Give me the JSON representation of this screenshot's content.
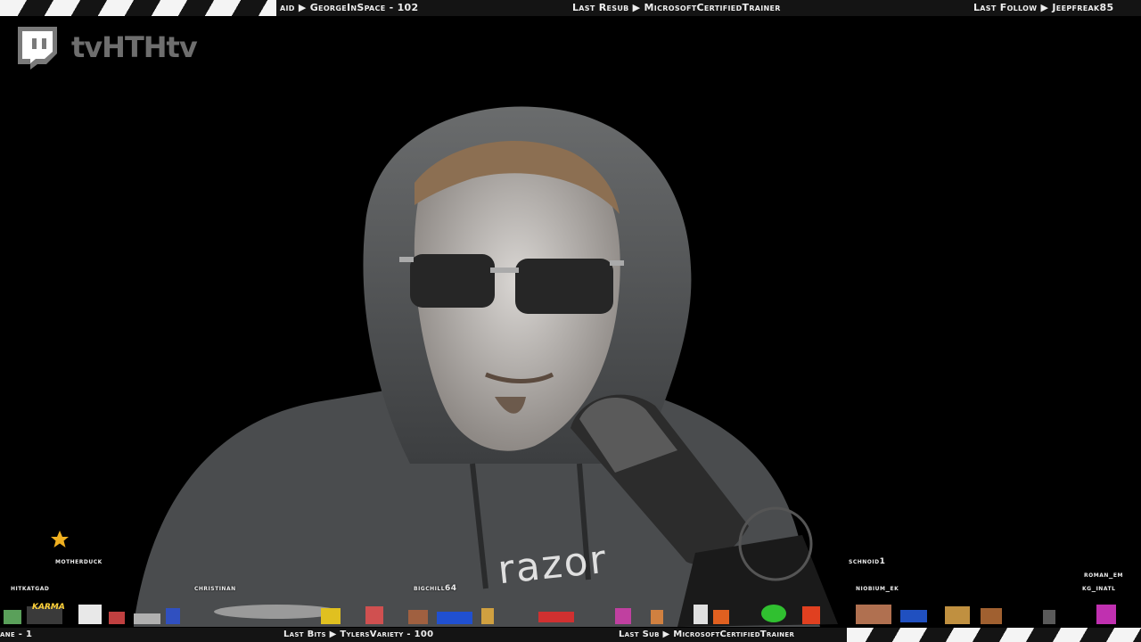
{
  "ticker_top": {
    "last_raid": "aid ▶ GeorgeInSpace - 102",
    "last_resub": "Last Resub ▶ MicrosoftCertifiedTrainer",
    "last_follow": "Last Follow ▶ Jeepfreak85"
  },
  "ticker_bottom": {
    "left_fragment": "ane - 1",
    "last_bits": "Last Bits ▶ TylersVariety - 100",
    "last_sub": "Last Sub ▶ MicrosoftCertifiedTrainer"
  },
  "logo": {
    "icon": "twitch-icon",
    "text": "tvHTHtv"
  },
  "chatters": [
    {
      "name": "motherduck"
    },
    {
      "name": "hitkatgad"
    },
    {
      "name": "christinan"
    },
    {
      "name": "bigchill64"
    },
    {
      "name": "schnoid1"
    },
    {
      "name": "niobium_ek"
    },
    {
      "name": "roman_em"
    },
    {
      "name": "kg_inatl"
    }
  ],
  "sprite_badge": {
    "text": "KARMA"
  },
  "hoodie_text": "razor",
  "colors": {
    "ticker_bg": "#141414",
    "stripe": "#f4f4f4",
    "logo_gray": "#6e6e6e",
    "background": "#000000"
  }
}
